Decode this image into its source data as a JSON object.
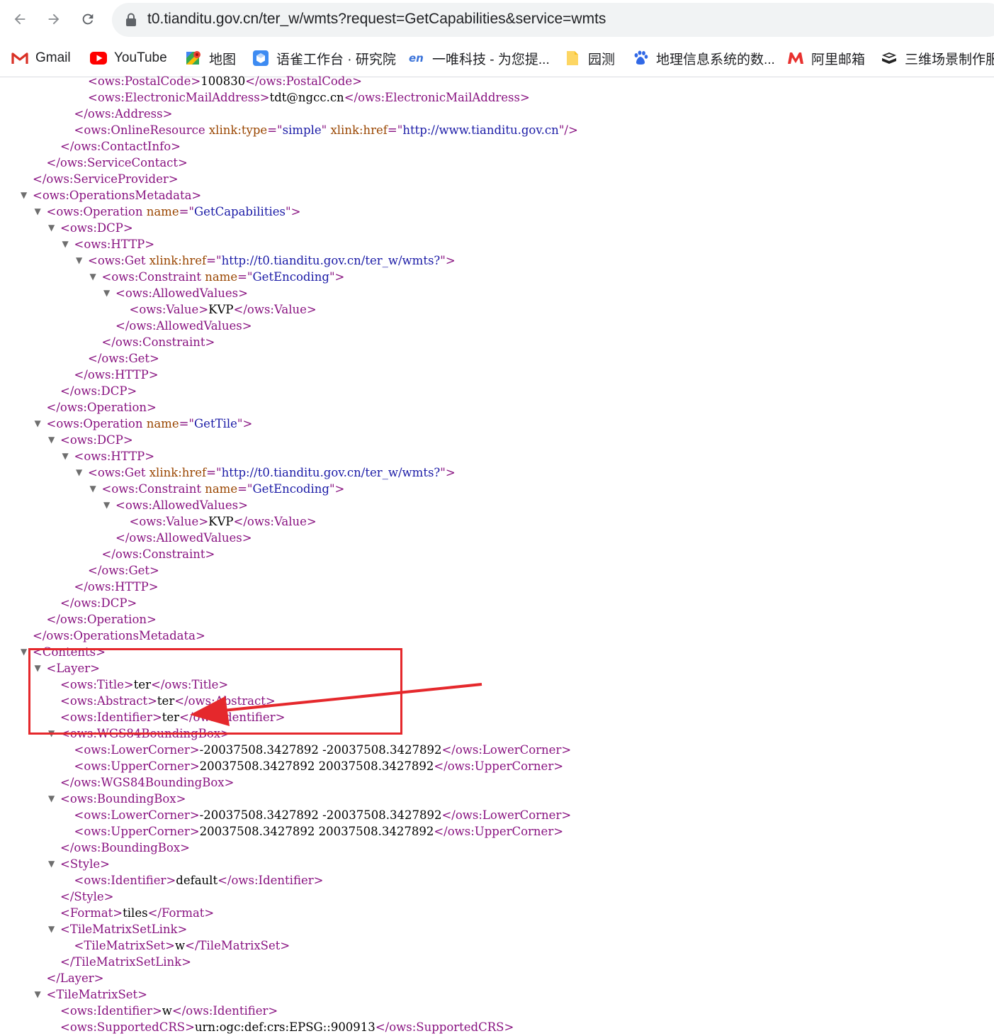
{
  "browser": {
    "url": "t0.tianditu.gov.cn/ter_w/wmts?request=GetCapabilities&service=wmts",
    "nav": {
      "back_icon": "arrow-left-icon",
      "forward_icon": "arrow-right-icon",
      "reload_icon": "reload-icon",
      "lock_icon": "lock-icon"
    },
    "bookmarks": [
      {
        "label": "Gmail",
        "icon": "gmail-icon"
      },
      {
        "label": "YouTube",
        "icon": "youtube-icon"
      },
      {
        "label": "地图",
        "icon": "maps-icon"
      },
      {
        "label": "语雀工作台 · 研究院",
        "icon": "yuque-icon"
      },
      {
        "label": "一唯科技 - 为您提...",
        "icon": "en-icon"
      },
      {
        "label": "园测",
        "icon": "folder-icon"
      },
      {
        "label": "地理信息系统的数...",
        "icon": "baidu-paw-icon"
      },
      {
        "label": "阿里邮箱",
        "icon": "aliyun-mail-icon"
      },
      {
        "label": "三维场景制作服",
        "icon": "link-icon"
      }
    ]
  },
  "colors": {
    "tag": "#881280",
    "attr_name": "#994500",
    "attr_value": "#1a1aa6",
    "text": "#000000",
    "annotation": "#e5282c"
  },
  "xml_lines": [
    {
      "indent": 6,
      "tw": false,
      "parts": [
        [
          "t",
          "<ows:PostalCode>"
        ],
        [
          "x",
          "100830"
        ],
        [
          "t",
          "</ows:PostalCode>"
        ]
      ]
    },
    {
      "indent": 6,
      "tw": false,
      "parts": [
        [
          "t",
          "<ows:ElectronicMailAddress>"
        ],
        [
          "x",
          "tdt@ngcc.cn"
        ],
        [
          "t",
          "</ows:ElectronicMailAddress>"
        ]
      ]
    },
    {
      "indent": 5,
      "tw": false,
      "parts": [
        [
          "t",
          "</ows:Address>"
        ]
      ]
    },
    {
      "indent": 5,
      "tw": false,
      "parts": [
        [
          "t",
          "<ows:OnlineResource "
        ],
        [
          "n",
          "xlink:type"
        ],
        [
          "t",
          "=\""
        ],
        [
          "v",
          "simple"
        ],
        [
          "t",
          "\" "
        ],
        [
          "n",
          "xlink:href"
        ],
        [
          "t",
          "=\""
        ],
        [
          "v",
          "http://www.tianditu.gov.cn"
        ],
        [
          "t",
          "\"/>"
        ]
      ]
    },
    {
      "indent": 4,
      "tw": false,
      "parts": [
        [
          "t",
          "</ows:ContactInfo>"
        ]
      ]
    },
    {
      "indent": 3,
      "tw": false,
      "parts": [
        [
          "t",
          "</ows:ServiceContact>"
        ]
      ]
    },
    {
      "indent": 2,
      "tw": false,
      "parts": [
        [
          "t",
          "</ows:ServiceProvider>"
        ]
      ]
    },
    {
      "indent": 2,
      "tw": true,
      "parts": [
        [
          "t",
          "<ows:OperationsMetadata>"
        ]
      ]
    },
    {
      "indent": 3,
      "tw": true,
      "parts": [
        [
          "t",
          "<ows:Operation "
        ],
        [
          "n",
          "name"
        ],
        [
          "t",
          "=\""
        ],
        [
          "v",
          "GetCapabilities"
        ],
        [
          "t",
          "\">"
        ]
      ]
    },
    {
      "indent": 4,
      "tw": true,
      "parts": [
        [
          "t",
          "<ows:DCP>"
        ]
      ]
    },
    {
      "indent": 5,
      "tw": true,
      "parts": [
        [
          "t",
          "<ows:HTTP>"
        ]
      ]
    },
    {
      "indent": 6,
      "tw": true,
      "parts": [
        [
          "t",
          "<ows:Get "
        ],
        [
          "n",
          "xlink:href"
        ],
        [
          "t",
          "=\""
        ],
        [
          "v",
          "http://t0.tianditu.gov.cn/ter_w/wmts?"
        ],
        [
          "t",
          "\">"
        ]
      ]
    },
    {
      "indent": 7,
      "tw": true,
      "parts": [
        [
          "t",
          "<ows:Constraint "
        ],
        [
          "n",
          "name"
        ],
        [
          "t",
          "=\""
        ],
        [
          "v",
          "GetEncoding"
        ],
        [
          "t",
          "\">"
        ]
      ]
    },
    {
      "indent": 8,
      "tw": true,
      "parts": [
        [
          "t",
          "<ows:AllowedValues>"
        ]
      ]
    },
    {
      "indent": 9,
      "tw": false,
      "parts": [
        [
          "t",
          "<ows:Value>"
        ],
        [
          "x",
          "KVP"
        ],
        [
          "t",
          "</ows:Value>"
        ]
      ]
    },
    {
      "indent": 8,
      "tw": false,
      "parts": [
        [
          "t",
          "</ows:AllowedValues>"
        ]
      ]
    },
    {
      "indent": 7,
      "tw": false,
      "parts": [
        [
          "t",
          "</ows:Constraint>"
        ]
      ]
    },
    {
      "indent": 6,
      "tw": false,
      "parts": [
        [
          "t",
          "</ows:Get>"
        ]
      ]
    },
    {
      "indent": 5,
      "tw": false,
      "parts": [
        [
          "t",
          "</ows:HTTP>"
        ]
      ]
    },
    {
      "indent": 4,
      "tw": false,
      "parts": [
        [
          "t",
          "</ows:DCP>"
        ]
      ]
    },
    {
      "indent": 3,
      "tw": false,
      "parts": [
        [
          "t",
          "</ows:Operation>"
        ]
      ]
    },
    {
      "indent": 3,
      "tw": true,
      "parts": [
        [
          "t",
          "<ows:Operation "
        ],
        [
          "n",
          "name"
        ],
        [
          "t",
          "=\""
        ],
        [
          "v",
          "GetTile"
        ],
        [
          "t",
          "\">"
        ]
      ]
    },
    {
      "indent": 4,
      "tw": true,
      "parts": [
        [
          "t",
          "<ows:DCP>"
        ]
      ]
    },
    {
      "indent": 5,
      "tw": true,
      "parts": [
        [
          "t",
          "<ows:HTTP>"
        ]
      ]
    },
    {
      "indent": 6,
      "tw": true,
      "parts": [
        [
          "t",
          "<ows:Get "
        ],
        [
          "n",
          "xlink:href"
        ],
        [
          "t",
          "=\""
        ],
        [
          "v",
          "http://t0.tianditu.gov.cn/ter_w/wmts?"
        ],
        [
          "t",
          "\">"
        ]
      ]
    },
    {
      "indent": 7,
      "tw": true,
      "parts": [
        [
          "t",
          "<ows:Constraint "
        ],
        [
          "n",
          "name"
        ],
        [
          "t",
          "=\""
        ],
        [
          "v",
          "GetEncoding"
        ],
        [
          "t",
          "\">"
        ]
      ]
    },
    {
      "indent": 8,
      "tw": true,
      "parts": [
        [
          "t",
          "<ows:AllowedValues>"
        ]
      ]
    },
    {
      "indent": 9,
      "tw": false,
      "parts": [
        [
          "t",
          "<ows:Value>"
        ],
        [
          "x",
          "KVP"
        ],
        [
          "t",
          "</ows:Value>"
        ]
      ]
    },
    {
      "indent": 8,
      "tw": false,
      "parts": [
        [
          "t",
          "</ows:AllowedValues>"
        ]
      ]
    },
    {
      "indent": 7,
      "tw": false,
      "parts": [
        [
          "t",
          "</ows:Constraint>"
        ]
      ]
    },
    {
      "indent": 6,
      "tw": false,
      "parts": [
        [
          "t",
          "</ows:Get>"
        ]
      ]
    },
    {
      "indent": 5,
      "tw": false,
      "parts": [
        [
          "t",
          "</ows:HTTP>"
        ]
      ]
    },
    {
      "indent": 4,
      "tw": false,
      "parts": [
        [
          "t",
          "</ows:DCP>"
        ]
      ]
    },
    {
      "indent": 3,
      "tw": false,
      "parts": [
        [
          "t",
          "</ows:Operation>"
        ]
      ]
    },
    {
      "indent": 2,
      "tw": false,
      "parts": [
        [
          "t",
          "</ows:OperationsMetadata>"
        ]
      ]
    },
    {
      "indent": 2,
      "tw": true,
      "parts": [
        [
          "t",
          "<Contents>"
        ]
      ]
    },
    {
      "indent": 3,
      "tw": true,
      "parts": [
        [
          "t",
          "<Layer>"
        ]
      ]
    },
    {
      "indent": 4,
      "tw": false,
      "parts": [
        [
          "t",
          "<ows:Title>"
        ],
        [
          "x",
          "ter"
        ],
        [
          "t",
          "</ows:Title>"
        ]
      ]
    },
    {
      "indent": 4,
      "tw": false,
      "parts": [
        [
          "t",
          "<ows:Abstract>"
        ],
        [
          "x",
          "ter"
        ],
        [
          "t",
          "</ows:Abstract>"
        ]
      ]
    },
    {
      "indent": 4,
      "tw": false,
      "parts": [
        [
          "t",
          "<ows:Identifier>"
        ],
        [
          "x",
          "ter"
        ],
        [
          "t",
          "</ows:Identifier>"
        ]
      ]
    },
    {
      "indent": 4,
      "tw": true,
      "parts": [
        [
          "t",
          "<ows:WGS84BoundingBox>"
        ]
      ]
    },
    {
      "indent": 5,
      "tw": false,
      "parts": [
        [
          "t",
          "<ows:LowerCorner>"
        ],
        [
          "x",
          "-20037508.3427892 -20037508.3427892"
        ],
        [
          "t",
          "</ows:LowerCorner>"
        ]
      ]
    },
    {
      "indent": 5,
      "tw": false,
      "parts": [
        [
          "t",
          "<ows:UpperCorner>"
        ],
        [
          "x",
          "20037508.3427892 20037508.3427892"
        ],
        [
          "t",
          "</ows:UpperCorner>"
        ]
      ]
    },
    {
      "indent": 4,
      "tw": false,
      "parts": [
        [
          "t",
          "</ows:WGS84BoundingBox>"
        ]
      ]
    },
    {
      "indent": 4,
      "tw": true,
      "parts": [
        [
          "t",
          "<ows:BoundingBox>"
        ]
      ]
    },
    {
      "indent": 5,
      "tw": false,
      "parts": [
        [
          "t",
          "<ows:LowerCorner>"
        ],
        [
          "x",
          "-20037508.3427892 -20037508.3427892"
        ],
        [
          "t",
          "</ows:LowerCorner>"
        ]
      ]
    },
    {
      "indent": 5,
      "tw": false,
      "parts": [
        [
          "t",
          "<ows:UpperCorner>"
        ],
        [
          "x",
          "20037508.3427892 20037508.3427892"
        ],
        [
          "t",
          "</ows:UpperCorner>"
        ]
      ]
    },
    {
      "indent": 4,
      "tw": false,
      "parts": [
        [
          "t",
          "</ows:BoundingBox>"
        ]
      ]
    },
    {
      "indent": 4,
      "tw": true,
      "parts": [
        [
          "t",
          "<Style>"
        ]
      ]
    },
    {
      "indent": 5,
      "tw": false,
      "parts": [
        [
          "t",
          "<ows:Identifier>"
        ],
        [
          "x",
          "default"
        ],
        [
          "t",
          "</ows:Identifier>"
        ]
      ]
    },
    {
      "indent": 4,
      "tw": false,
      "parts": [
        [
          "t",
          "</Style>"
        ]
      ]
    },
    {
      "indent": 4,
      "tw": false,
      "parts": [
        [
          "t",
          "<Format>"
        ],
        [
          "x",
          "tiles"
        ],
        [
          "t",
          "</Format>"
        ]
      ]
    },
    {
      "indent": 4,
      "tw": true,
      "parts": [
        [
          "t",
          "<TileMatrixSetLink>"
        ]
      ]
    },
    {
      "indent": 5,
      "tw": false,
      "parts": [
        [
          "t",
          "<TileMatrixSet>"
        ],
        [
          "x",
          "w"
        ],
        [
          "t",
          "</TileMatrixSet>"
        ]
      ]
    },
    {
      "indent": 4,
      "tw": false,
      "parts": [
        [
          "t",
          "</TileMatrixSetLink>"
        ]
      ]
    },
    {
      "indent": 3,
      "tw": false,
      "parts": [
        [
          "t",
          "</Layer>"
        ]
      ]
    },
    {
      "indent": 3,
      "tw": true,
      "parts": [
        [
          "t",
          "<TileMatrixSet>"
        ]
      ]
    },
    {
      "indent": 4,
      "tw": false,
      "parts": [
        [
          "t",
          "<ows:Identifier>"
        ],
        [
          "x",
          "w"
        ],
        [
          "t",
          "</ows:Identifier>"
        ]
      ]
    },
    {
      "indent": 4,
      "tw": false,
      "parts": [
        [
          "t",
          "<ows:SupportedCRS>"
        ],
        [
          "x",
          "urn:ogc:def:crs:EPSG::900913"
        ],
        [
          "t",
          "</ows:SupportedCRS>"
        ]
      ]
    }
  ]
}
